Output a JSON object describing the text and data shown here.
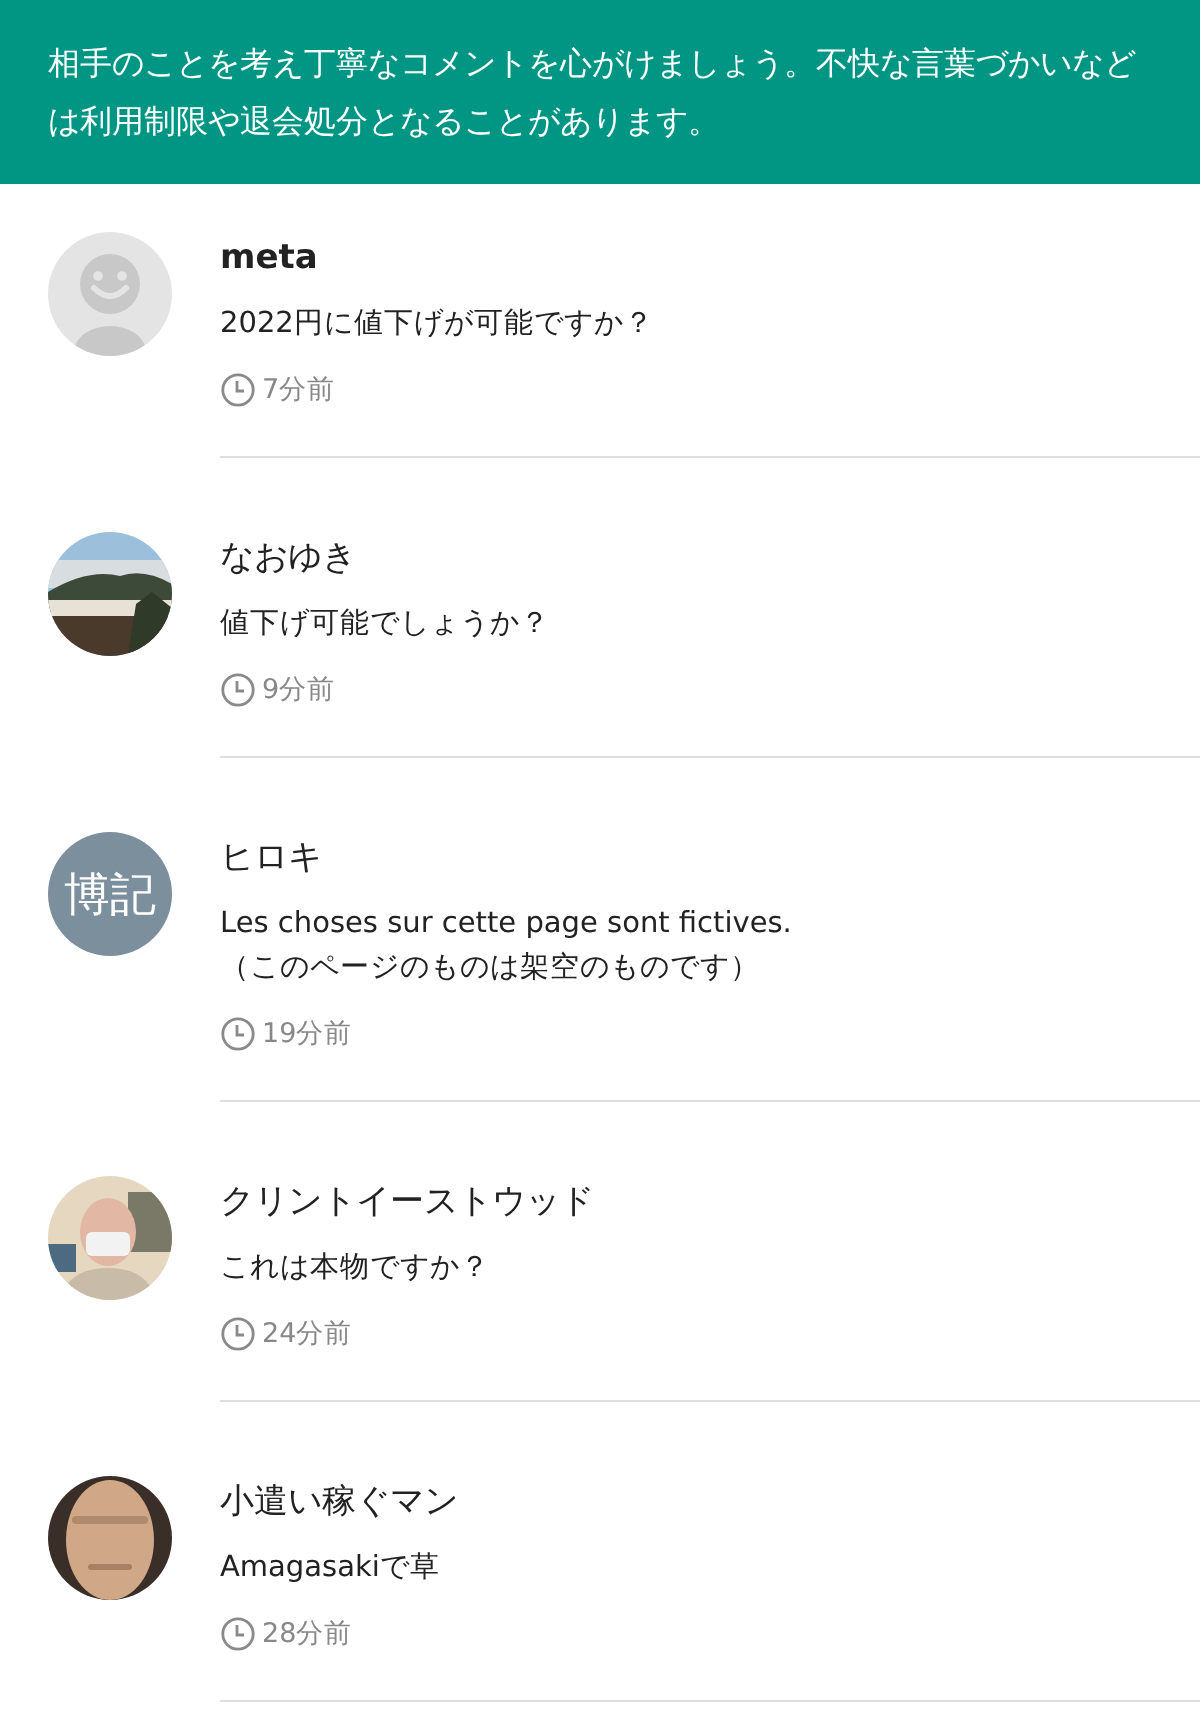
{
  "notice": {
    "text": "相手のことを考え丁寧なコメントを心がけましょう。不快な言葉づかいなどは利用制限や退会処分となることがあります。"
  },
  "comments": [
    {
      "avatar": {
        "kind": "default"
      },
      "name": "meta",
      "name_bold": true,
      "message": "2022円に値下げが可能ですか？",
      "time": "7分前"
    },
    {
      "name": "なおゆき",
      "name_bold": false,
      "message": "値下げ可能でしょうか？",
      "time": "9分前"
    },
    {
      "avatar": {
        "kind": "text",
        "text": "博記"
      },
      "name": "ヒロキ",
      "name_bold": false,
      "message": "Les choses sur cette page sont fictives.\n（このページのものは架空のものです）",
      "time": "19分前"
    },
    {
      "avatar": {
        "kind": "person"
      },
      "name": "クリントイーストウッド",
      "name_bold": false,
      "message": "これは本物ですか？",
      "time": "24分前"
    },
    {
      "avatar": {
        "kind": "person2"
      },
      "name": "小遣い稼ぐマン",
      "name_bold": false,
      "message": "Amagasakiで草",
      "time": "28分前"
    }
  ]
}
